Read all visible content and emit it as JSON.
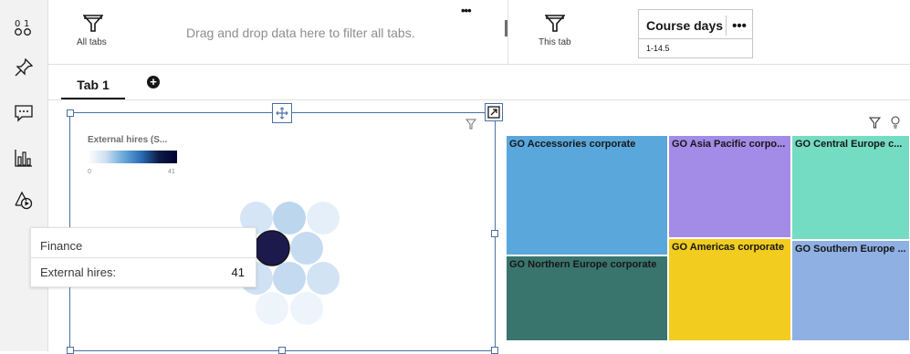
{
  "left_toolbar": {
    "icons": [
      "sort-numeric-icon",
      "pin-icon",
      "comment-icon",
      "bar-chart-icon",
      "shapes-play-icon"
    ]
  },
  "filters": {
    "all_tabs_label": "All tabs",
    "all_tabs_hint": "Drag and drop data here to filter all tabs.",
    "more_label": "•••",
    "this_tab_label": "This tab",
    "course_card": {
      "title": "Course days",
      "more": "•••",
      "value": "1-14.5"
    }
  },
  "tabs": {
    "items": [
      {
        "label": "Tab 1"
      }
    ],
    "add_label": "+"
  },
  "bubble_widget": {
    "legend_title": "External hires (S...",
    "legend_min": "0",
    "legend_max": "41",
    "tooltip": {
      "name": "Finance",
      "measure_label": "External hires:",
      "measure_value": "41"
    }
  },
  "treemap": {
    "tiles": [
      {
        "label": "GO Accessories corporate",
        "color": "#5aa7dc"
      },
      {
        "label": "GO Asia Pacific corpo...",
        "color": "#a38ce8"
      },
      {
        "label": "GO Central Europe c...",
        "color": "#74dcc2"
      },
      {
        "label": "GO Americas corporate",
        "color": "#f2cd1f"
      },
      {
        "label": "GO Southern Europe ...",
        "color": "#8fb0e3"
      },
      {
        "label": "GO Northern Europe corporate",
        "color": "#3a756d"
      }
    ]
  },
  "colors": {
    "accent": "#4a6fa5",
    "bubble_dark": "#1c1a4d",
    "bubble_light": "#cfe1f2"
  }
}
